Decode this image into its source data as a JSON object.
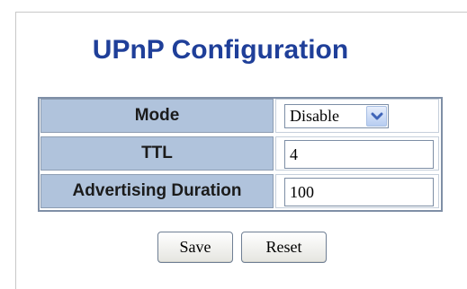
{
  "page": {
    "title": "UPnP Configuration"
  },
  "form": {
    "rows": [
      {
        "label": "Mode",
        "value": "Disable",
        "control": "select"
      },
      {
        "label": "TTL",
        "value": "4",
        "control": "text"
      },
      {
        "label": "Advertising Duration",
        "value": "100",
        "control": "text"
      }
    ]
  },
  "buttons": {
    "save": "Save",
    "reset": "Reset"
  },
  "icons": {
    "select_arrow": "chevron-down-icon"
  },
  "colors": {
    "title": "#1f3f99",
    "label_background": "#b0c3dc",
    "border": "#7f8fa6"
  }
}
